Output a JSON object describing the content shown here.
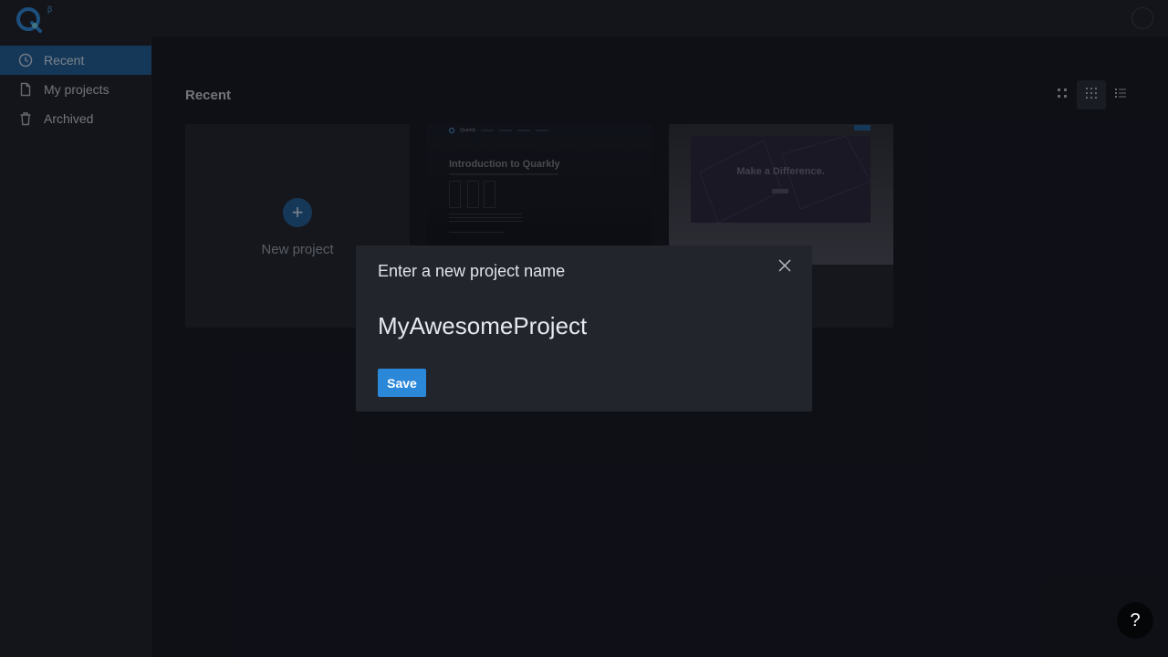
{
  "app": {
    "logo_letter": "Q",
    "badge": "β"
  },
  "sidebar": {
    "items": [
      {
        "label": "Recent",
        "icon": "clock-icon",
        "active": true
      },
      {
        "label": "My projects",
        "icon": "document-icon",
        "active": false
      },
      {
        "label": "Archived",
        "icon": "trash-icon",
        "active": false
      }
    ]
  },
  "main": {
    "title": "Recent",
    "view_options": [
      "large-grid-icon",
      "small-grid-icon",
      "list-icon"
    ],
    "active_view": "small-grid-icon",
    "new_project_label": "New project",
    "projects": [
      {
        "thumb_title": "Introduction to Quarkly",
        "brand": "Quarkly"
      },
      {
        "thumb_title": "Make a Difference."
      }
    ]
  },
  "modal": {
    "title": "Enter a new project name",
    "input_value": "MyAwesomeProject",
    "save_label": "Save"
  },
  "help": {
    "label": "?"
  },
  "colors": {
    "accent": "#1f5d94",
    "button": "#2b87d8",
    "background": "#13151c",
    "panel": "#1c1e25"
  }
}
